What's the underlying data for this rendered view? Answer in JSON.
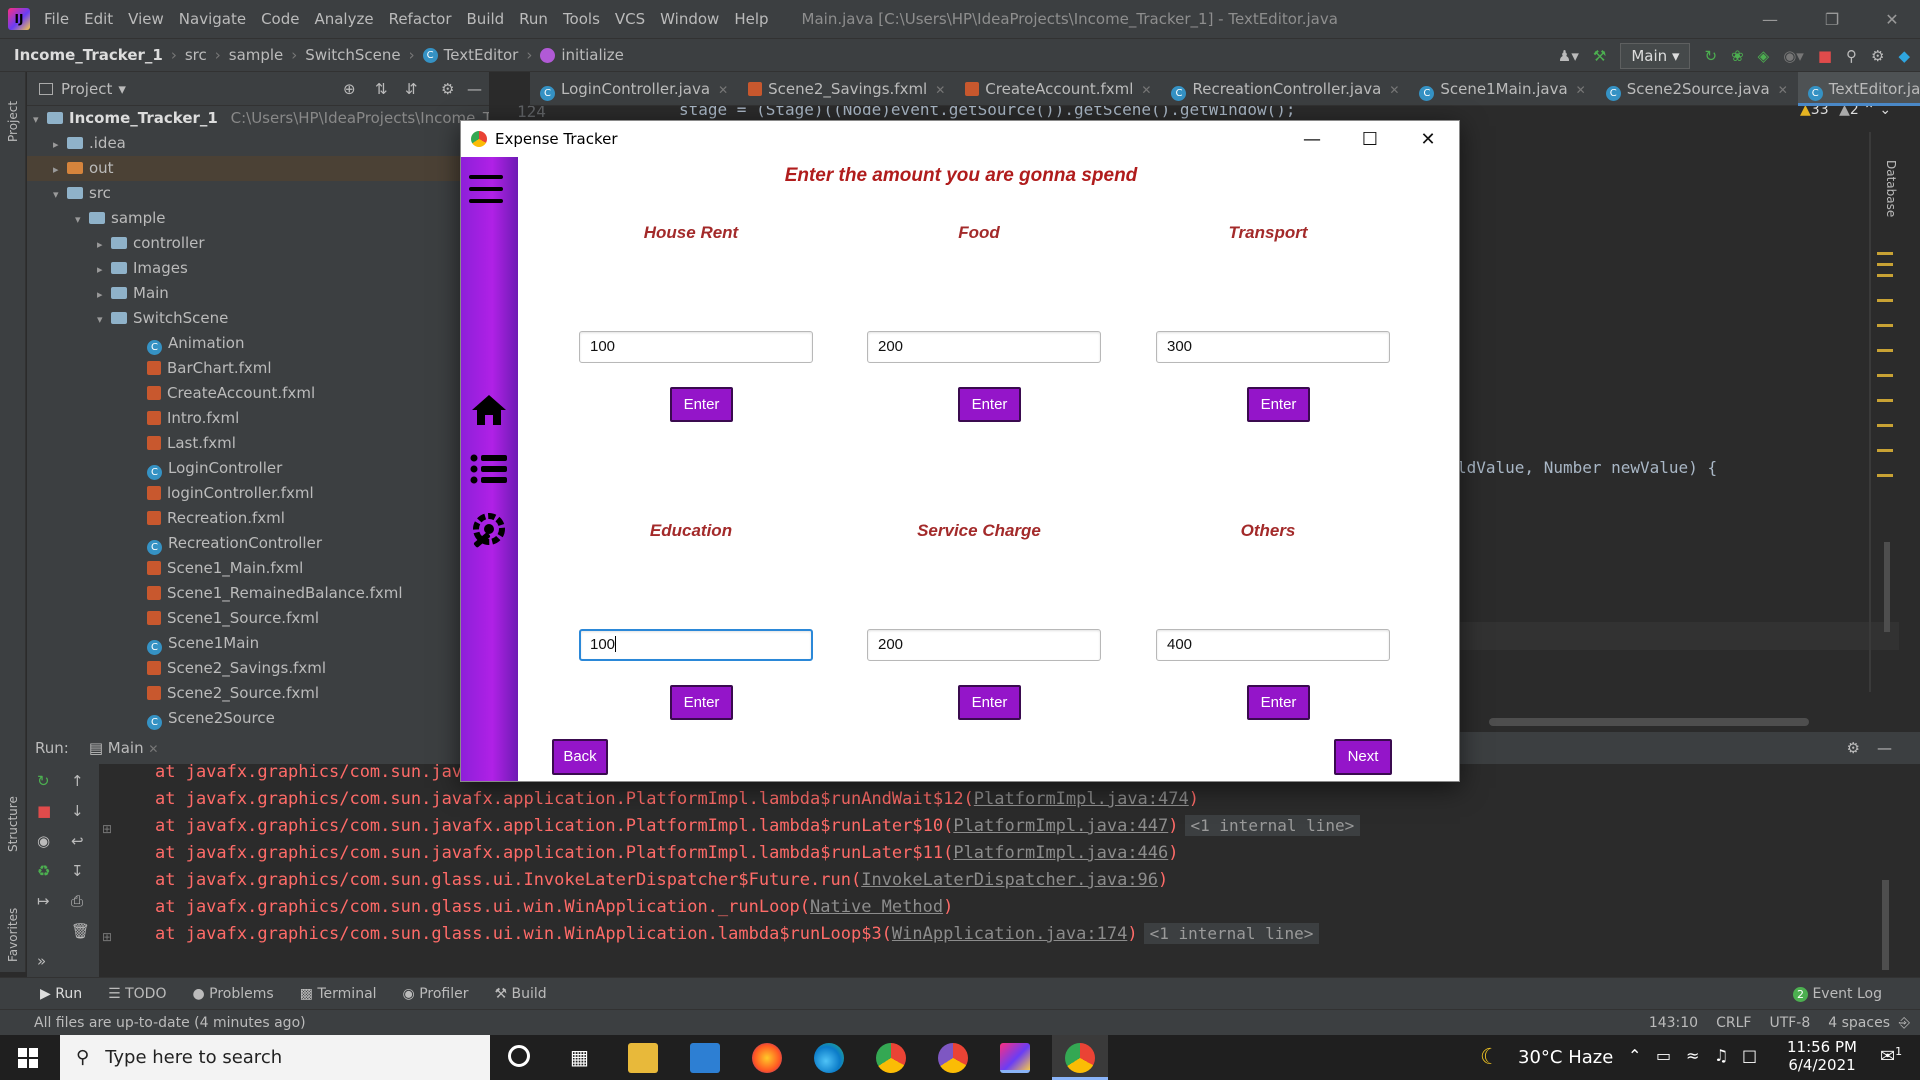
{
  "ide": {
    "menu": [
      "File",
      "Edit",
      "View",
      "Navigate",
      "Code",
      "Analyze",
      "Refactor",
      "Build",
      "Run",
      "Tools",
      "VCS",
      "Window",
      "Help"
    ],
    "window_title": "Main.java [C:\\Users\\HP\\IdeaProjects\\Income_Tracker_1] - TextEditor.java",
    "breadcrumb": [
      "Income_Tracker_1",
      "src",
      "sample",
      "SwitchScene",
      "TextEditor",
      "initialize"
    ],
    "run_config": "Main",
    "project_label": "Project",
    "project_root": "Income_Tracker_1",
    "project_path": "C:\\Users\\HP\\IdeaProjects\\Income_Tracker_1",
    "tree": [
      ".idea",
      "out",
      "src",
      "sample",
      "controller",
      "Images",
      "Main",
      "SwitchScene",
      "Animation",
      "BarChart.fxml",
      "CreateAccount.fxml",
      "Intro.fxml",
      "Last.fxml",
      "LoginController",
      "loginController.fxml",
      "Recreation.fxml",
      "RecreationController",
      "Scene1_Main.fxml",
      "Scene1_RemainedBalance.fxml",
      "Scene1_Source.fxml",
      "Scene1Main",
      "Scene2_Savings.fxml",
      "Scene2_Source.fxml",
      "Scene2Source"
    ],
    "tabs": [
      "LoginController.java",
      "Scene2_Savings.fxml",
      "CreateAccount.fxml",
      "RecreationController.java",
      "Scene1Main.java",
      "Scene2Source.java",
      "TextEditor.java"
    ],
    "code_line_no": "124",
    "code_line_1": "stage = (Stage)((Node)event.getSource()).getScene().getWindow();",
    "code_line_2": "ldValue, Number newValue) {",
    "warnings": "33",
    "weak_warnings": "2",
    "run_label": "Run:",
    "run_tab": "Main",
    "trace": [
      {
        "text": "at javafx.graphics/com.sun.java",
        "link": "",
        "pill": ""
      },
      {
        "text": "at javafx.graphics/com.sun.javafx.application.PlatformImpl.lambda$runAndWait$12(",
        "link": "PlatformImpl.java:474",
        "pill": ""
      },
      {
        "text": "at javafx.graphics/com.sun.javafx.application.PlatformImpl.lambda$runLater$10(",
        "link": "PlatformImpl.java:447",
        "pill": "<1 internal line>"
      },
      {
        "text": "at javafx.graphics/com.sun.javafx.application.PlatformImpl.lambda$runLater$11(",
        "link": "PlatformImpl.java:446",
        "pill": ""
      },
      {
        "text": "at javafx.graphics/com.sun.glass.ui.InvokeLaterDispatcher$Future.run(",
        "link": "InvokeLaterDispatcher.java:96",
        "pill": ""
      },
      {
        "text": "at javafx.graphics/com.sun.glass.ui.win.WinApplication._runLoop(",
        "link": "Native Method",
        "pill": ""
      },
      {
        "text": "at javafx.graphics/com.sun.glass.ui.win.WinApplication.lambda$runLoop$3(",
        "link": "WinApplication.java:174",
        "pill": "<1 internal line>"
      }
    ],
    "bottom_tools": [
      "Run",
      "TODO",
      "Problems",
      "Terminal",
      "Profiler",
      "Build"
    ],
    "event_log": "Event Log",
    "event_log_count": "2",
    "status_message": "All files are up-to-date (4 minutes ago)",
    "status_right": [
      "143:10",
      "CRLF",
      "UTF-8",
      "4 spaces"
    ],
    "side_tabs": {
      "project": "Project",
      "structure": "Structure",
      "favorites": "Favorites",
      "database": "Database"
    }
  },
  "app": {
    "title": "Expense Tracker",
    "heading": "Enter the amount you are gonna spend",
    "categories": [
      {
        "label": "House Rent",
        "value": "100"
      },
      {
        "label": "Food",
        "value": "200"
      },
      {
        "label": "Transport",
        "value": "300"
      },
      {
        "label": "Education",
        "value": "100"
      },
      {
        "label": "Service Charge",
        "value": "200"
      },
      {
        "label": "Others",
        "value": "400"
      }
    ],
    "enter_label": "Enter",
    "back_label": "Back",
    "next_label": "Next"
  },
  "taskbar": {
    "search_placeholder": "Type here to search",
    "weather": "30°C  Haze",
    "time": "11:56 PM",
    "date": "6/4/2021",
    "notifications": "1"
  },
  "colors": {
    "app_accent": "#9415c9",
    "app_sidebar": "#b021e6",
    "heading_red": "#b01c1c",
    "ide_bg": "#2b2b2b",
    "trace_red": "#ff6b68"
  }
}
